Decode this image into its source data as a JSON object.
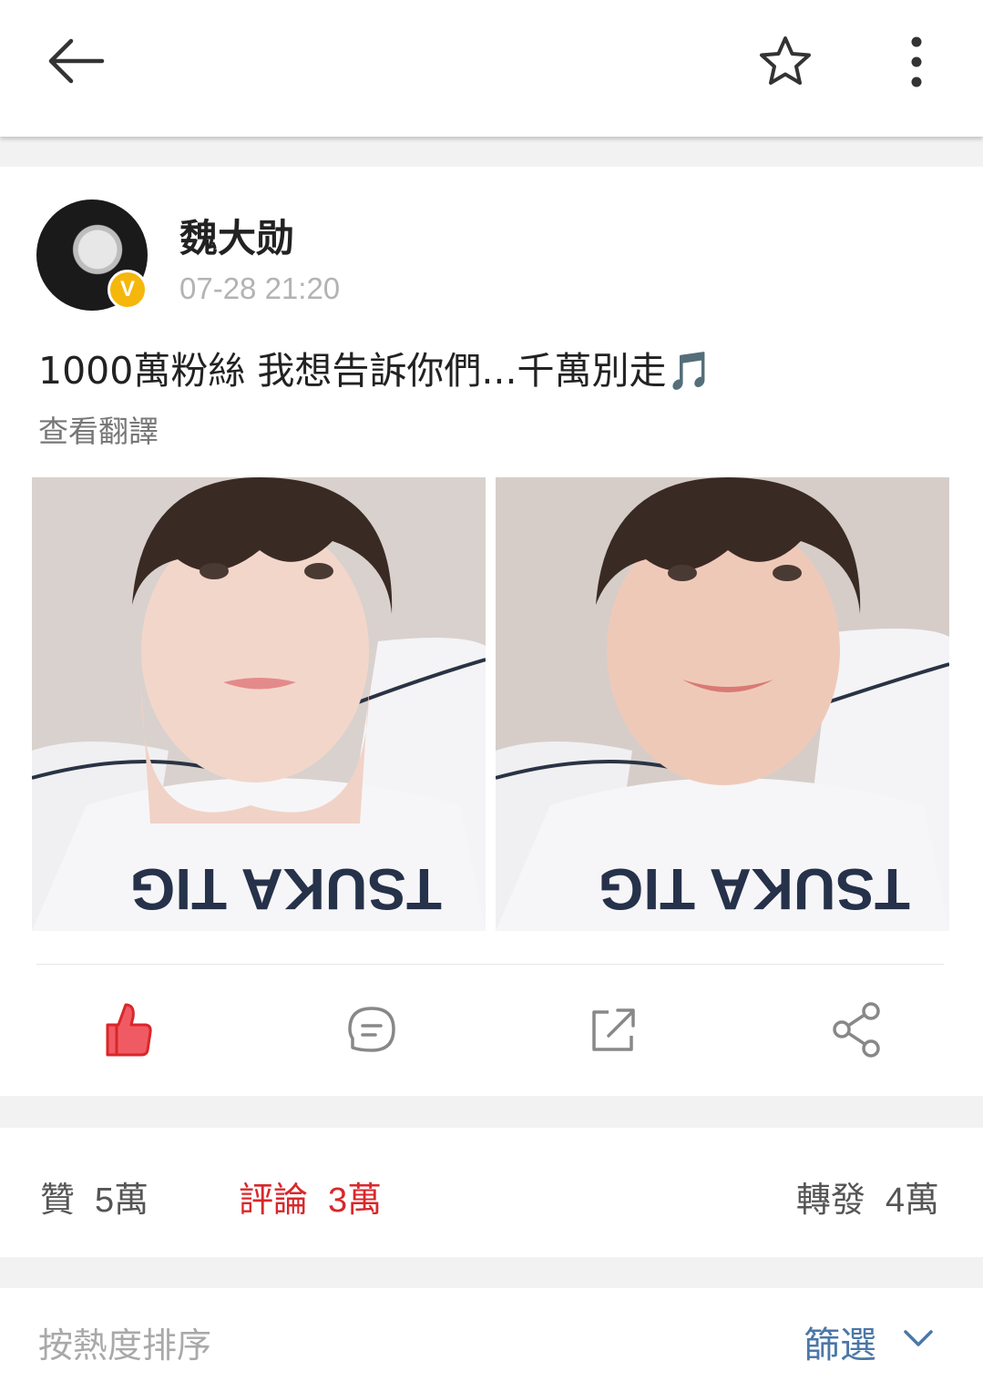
{
  "topbar": {
    "back_icon": "arrow-left-icon",
    "favorite_icon": "star-outline-icon",
    "more_icon": "more-vertical-icon"
  },
  "post": {
    "author": "魏大勋",
    "verified_badge": "V",
    "timestamp": "07-28 21:20",
    "text": "1000萬粉絲 我想告訴你們...千萬別走",
    "emoji": "🎵",
    "translate_link": "查看翻譯",
    "images": [
      "selfie-photo-1",
      "selfie-photo-2"
    ],
    "actions": {
      "like_icon": "thumbs-up-filled-icon",
      "comment_icon": "comment-bubble-icon",
      "repost_icon": "repost-icon",
      "share_icon": "share-icon"
    },
    "colors": {
      "accent_red": "#d9272b",
      "like_red": "#f05b63",
      "link_blue": "#4b77a8"
    }
  },
  "stats": {
    "likes_label": "贊",
    "likes_count": "5萬",
    "comments_label": "評論",
    "comments_count": "3萬",
    "reposts_label": "轉發",
    "reposts_count": "4萬"
  },
  "sort": {
    "label": "按熱度排序",
    "filter_label": "篩選"
  }
}
